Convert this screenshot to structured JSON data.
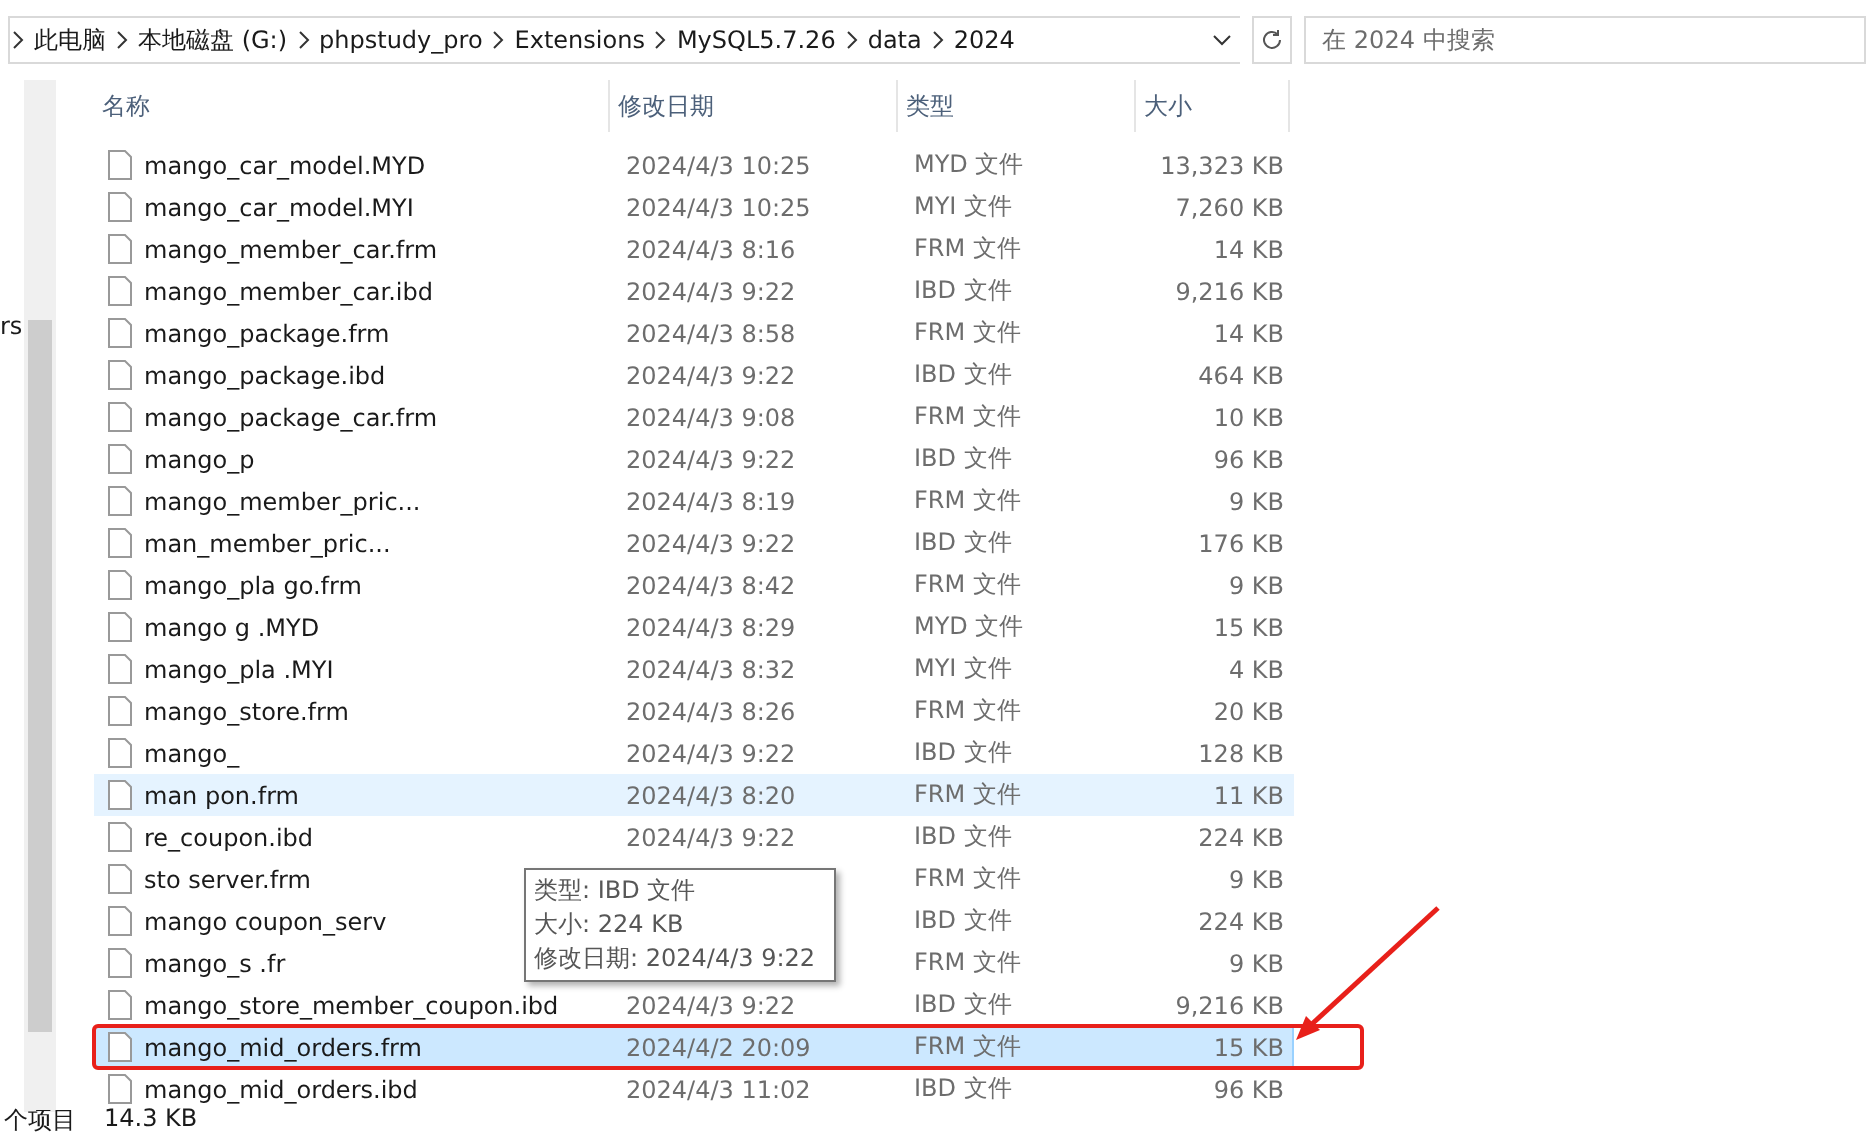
{
  "address_bar": {
    "crumbs": [
      "此电脑",
      "本地磁盘 (G:)",
      "phpstudy_pro",
      "Extensions",
      "MySQL5.7.26",
      "data",
      "2024"
    ]
  },
  "search": {
    "placeholder": "在 2024 中搜索"
  },
  "nav_pane": {
    "fragment": "rs"
  },
  "columns": [
    "名称",
    "修改日期",
    "类型",
    "大小"
  ],
  "rows": [
    {
      "name": "mango_car_model.MYD",
      "date": "2024/4/3 10:25",
      "type": "MYD 文件",
      "size": "13,323 KB",
      "selected": false,
      "hovered": false
    },
    {
      "name": "mango_car_model.MYI",
      "date": "2024/4/3 10:25",
      "type": "MYI 文件",
      "size": "7,260 KB",
      "selected": false,
      "hovered": false
    },
    {
      "name": "mango_member_car.frm",
      "date": "2024/4/3 8:16",
      "type": "FRM 文件",
      "size": "14 KB",
      "selected": false,
      "hovered": false
    },
    {
      "name": "mango_member_car.ibd",
      "date": "2024/4/3 9:22",
      "type": "IBD 文件",
      "size": "9,216 KB",
      "selected": false,
      "hovered": false
    },
    {
      "name": "mango_package.frm",
      "date": "2024/4/3 8:58",
      "type": "FRM 文件",
      "size": "14 KB",
      "selected": false,
      "hovered": false
    },
    {
      "name": "mango_package.ibd",
      "date": "2024/4/3 9:22",
      "type": "IBD 文件",
      "size": "464 KB",
      "selected": false,
      "hovered": false
    },
    {
      "name": "mango_package_car.frm",
      "date": "2024/4/3 9:08",
      "type": "FRM 文件",
      "size": "10 KB",
      "selected": false,
      "hovered": false
    },
    {
      "name": "mango_p",
      "date": "2024/4/3 9:22",
      "type": "IBD 文件",
      "size": "96 KB",
      "selected": false,
      "hovered": false
    },
    {
      "name": "mango_member_pric...",
      "date": "2024/4/3 8:19",
      "type": "FRM 文件",
      "size": "9 KB",
      "selected": false,
      "hovered": false
    },
    {
      "name": "man_member_pric...",
      "date": "2024/4/3 9:22",
      "type": "IBD 文件",
      "size": "176 KB",
      "selected": false,
      "hovered": false
    },
    {
      "name": "mango_pla go.frm",
      "date": "2024/4/3 8:42",
      "type": "FRM 文件",
      "size": "9 KB",
      "selected": false,
      "hovered": false
    },
    {
      "name": "mango g .MYD",
      "date": "2024/4/3 8:29",
      "type": "MYD 文件",
      "size": "15 KB",
      "selected": false,
      "hovered": false
    },
    {
      "name": "mango_pla .MYI",
      "date": "2024/4/3 8:32",
      "type": "MYI 文件",
      "size": "4 KB",
      "selected": false,
      "hovered": false
    },
    {
      "name": "mango_store.frm",
      "date": "2024/4/3 8:26",
      "type": "FRM 文件",
      "size": "20 KB",
      "selected": false,
      "hovered": false
    },
    {
      "name": "mango_",
      "date": "2024/4/3 9:22",
      "type": "IBD 文件",
      "size": "128 KB",
      "selected": false,
      "hovered": false
    },
    {
      "name": "man pon.frm",
      "date": "2024/4/3 8:20",
      "type": "FRM 文件",
      "size": "11 KB",
      "selected": false,
      "hovered": true
    },
    {
      "name": "re_coupon.ibd",
      "date": "2024/4/3 9:22",
      "type": "IBD 文件",
      "size": "224 KB",
      "selected": false,
      "hovered": false
    },
    {
      "name": "sto server.frm",
      "type": "FRM 文件",
      "size": "9 KB",
      "selected": false,
      "hovered": false
    },
    {
      "name": "mango coupon_serv",
      "type": "IBD 文件",
      "size": "224 KB",
      "selected": false,
      "hovered": false
    },
    {
      "name": "mango_s .fr",
      "type": "FRM 文件",
      "size": "9 KB",
      "selected": false,
      "hovered": false
    },
    {
      "name": "mango_store_member_coupon.ibd",
      "date": "2024/4/3 9:22",
      "type": "IBD 文件",
      "size": "9,216 KB",
      "selected": false,
      "hovered": false
    },
    {
      "name": "mango_mid_orders.frm",
      "date": "2024/4/2 20:09",
      "type": "FRM 文件",
      "size": "15 KB",
      "selected": true,
      "hovered": false
    },
    {
      "name": "mango_mid_orders.ibd",
      "date": "2024/4/3 11:02",
      "type": "IBD 文件",
      "size": "96 KB",
      "selected": false,
      "hovered": false
    }
  ],
  "tooltip": {
    "lines": [
      "类型: IBD 文件",
      "大小: 224 KB",
      "修改日期: 2024/4/3 9:22"
    ]
  },
  "status_bar": {
    "count": "个项目",
    "size": "14.3 KB"
  }
}
